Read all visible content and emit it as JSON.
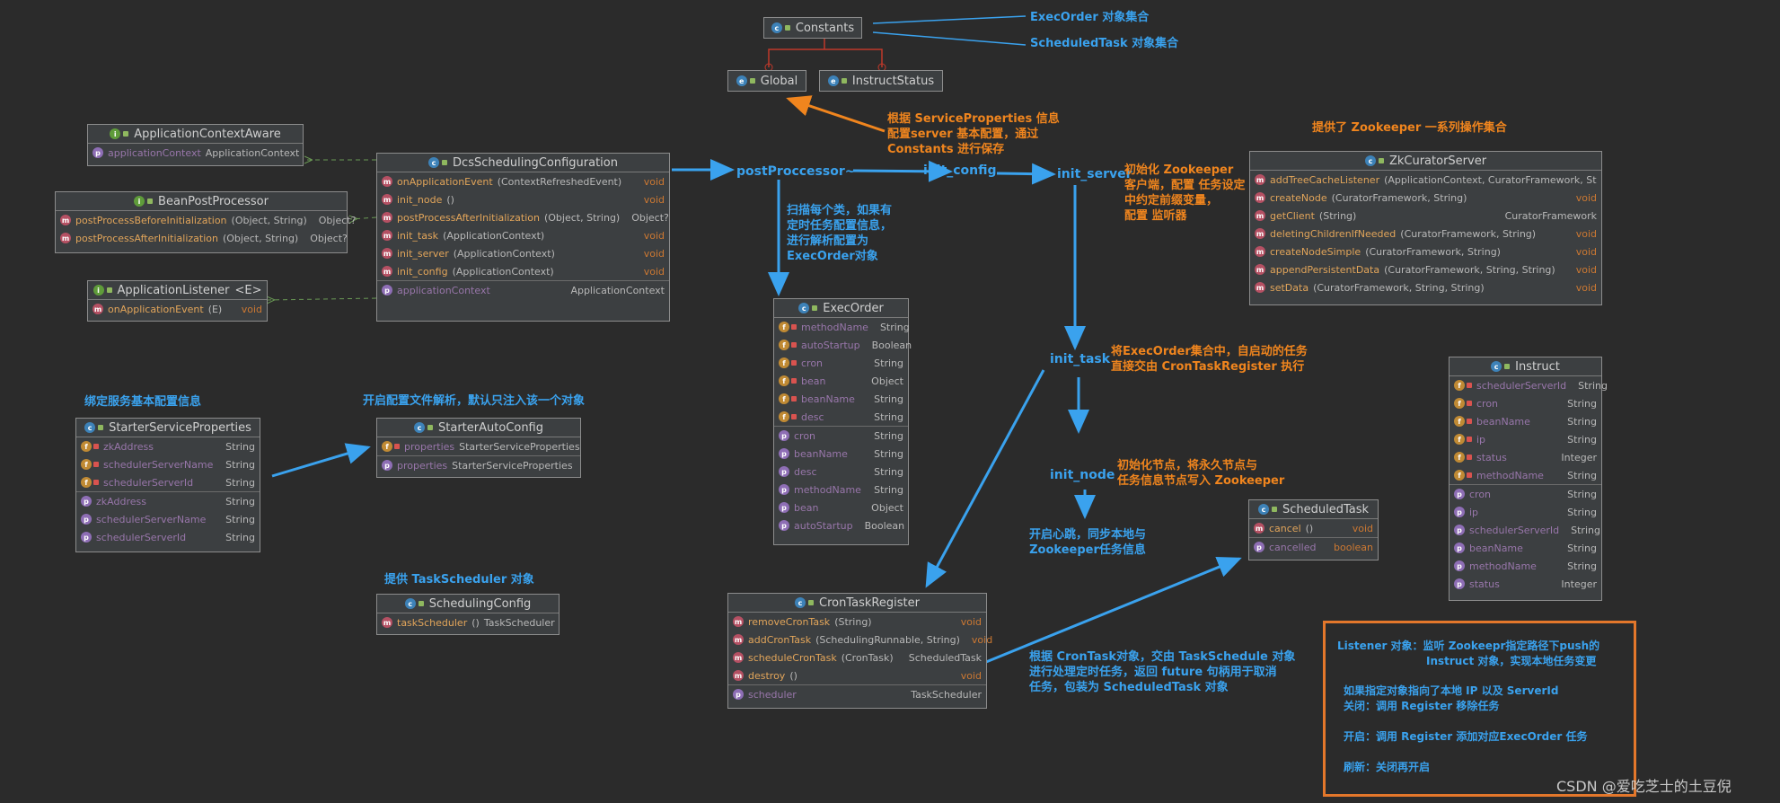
{
  "classes": {
    "constants": {
      "name": "Constants"
    },
    "global": {
      "name": "Global"
    },
    "instruct_status": {
      "name": "InstructStatus"
    },
    "application_context_aware": {
      "name": "ApplicationContextAware",
      "rows": [
        {
          "name": "applicationContext",
          "type": "ApplicationContext"
        }
      ]
    },
    "bean_post_processor": {
      "name": "BeanPostProcessor",
      "rows": [
        {
          "name": "postProcessBeforeInitialization",
          "args": "(Object, String)",
          "type": "Object?"
        },
        {
          "name": "postProcessAfterInitialization",
          "args": "(Object, String)",
          "type": "Object?"
        }
      ]
    },
    "application_listener": {
      "name": "ApplicationListener",
      "generic": "<E>",
      "rows": [
        {
          "name": "onApplicationEvent",
          "args": "(E)",
          "type": "void"
        }
      ]
    },
    "dcs_config": {
      "name": "DcsSchedulingConfiguration",
      "rows": [
        {
          "name": "onApplicationEvent",
          "args": "(ContextRefreshedEvent)",
          "type": "void"
        },
        {
          "name": "init_node",
          "args": "()",
          "type": "void"
        },
        {
          "name": "postProcessAfterInitialization",
          "args": "(Object, String)",
          "type": "Object?"
        },
        {
          "name": "init_task",
          "args": "(ApplicationContext)",
          "type": "void"
        },
        {
          "name": "init_server",
          "args": "(ApplicationContext)",
          "type": "void"
        },
        {
          "name": "init_config",
          "args": "(ApplicationContext)",
          "type": "void"
        },
        {
          "name": "applicationContext",
          "args": "",
          "type": "ApplicationContext"
        }
      ]
    },
    "exec_order": {
      "name": "ExecOrder",
      "rows": [
        {
          "name": "methodName",
          "type": "String"
        },
        {
          "name": "autoStartup",
          "type": "Boolean"
        },
        {
          "name": "cron",
          "type": "String"
        },
        {
          "name": "bean",
          "type": "Object"
        },
        {
          "name": "beanName",
          "type": "String"
        },
        {
          "name": "desc",
          "type": "String"
        },
        {
          "name": "cron",
          "type": "String"
        },
        {
          "name": "beanName",
          "type": "String"
        },
        {
          "name": "desc",
          "type": "String"
        },
        {
          "name": "methodName",
          "type": "String"
        },
        {
          "name": "bean",
          "type": "Object"
        },
        {
          "name": "autoStartup",
          "type": "Boolean"
        }
      ]
    },
    "zk_curator_server": {
      "name": "ZkCuratorServer",
      "rows": [
        {
          "name": "addTreeCacheListener",
          "args": "(ApplicationContext, CuratorFramework, String)",
          "type": ""
        },
        {
          "name": "createNode",
          "args": "(CuratorFramework, String)",
          "type": "void"
        },
        {
          "name": "getClient",
          "args": "(String)",
          "type": "CuratorFramework"
        },
        {
          "name": "deletingChildrenIfNeeded",
          "args": "(CuratorFramework, String)",
          "type": "void"
        },
        {
          "name": "createNodeSimple",
          "args": "(CuratorFramework, String)",
          "type": "void"
        },
        {
          "name": "appendPersistentData",
          "args": "(CuratorFramework, String, String)",
          "type": "void"
        },
        {
          "name": "setData",
          "args": "(CuratorFramework, String, String)",
          "type": "void"
        }
      ]
    },
    "instruct": {
      "name": "Instruct",
      "rows": [
        {
          "name": "schedulerServerId",
          "type": "String"
        },
        {
          "name": "cron",
          "type": "String"
        },
        {
          "name": "beanName",
          "type": "String"
        },
        {
          "name": "ip",
          "type": "String"
        },
        {
          "name": "status",
          "type": "Integer"
        },
        {
          "name": "methodName",
          "type": "String"
        },
        {
          "name": "cron",
          "type": "String"
        },
        {
          "name": "ip",
          "type": "String"
        },
        {
          "name": "schedulerServerId",
          "type": "String"
        },
        {
          "name": "beanName",
          "type": "String"
        },
        {
          "name": "methodName",
          "type": "String"
        },
        {
          "name": "status",
          "type": "Integer"
        }
      ]
    },
    "scheduled_task": {
      "name": "ScheduledTask",
      "rows": [
        {
          "name": "cancel",
          "args": "()",
          "type": "void"
        },
        {
          "name": "cancelled",
          "args": "",
          "type": "boolean"
        }
      ]
    },
    "starter_service_properties": {
      "name": "StarterServiceProperties",
      "rows": [
        {
          "name": "zkAddress",
          "type": "String"
        },
        {
          "name": "schedulerServerName",
          "type": "String"
        },
        {
          "name": "schedulerServerId",
          "type": "String"
        },
        {
          "name": "zkAddress",
          "type": "String"
        },
        {
          "name": "schedulerServerName",
          "type": "String"
        },
        {
          "name": "schedulerServerId",
          "type": "String"
        }
      ]
    },
    "starter_auto_config": {
      "name": "StarterAutoConfig",
      "rows": [
        {
          "name": "properties",
          "type": "StarterServiceProperties"
        },
        {
          "name": "properties",
          "type": "StarterServiceProperties"
        }
      ]
    },
    "scheduling_config": {
      "name": "SchedulingConfig",
      "rows": [
        {
          "name": "taskScheduler",
          "args": "()",
          "type": "TaskScheduler"
        }
      ]
    },
    "cron_task_register": {
      "name": "CronTaskRegister",
      "rows": [
        {
          "name": "removeCronTask",
          "args": "(String)",
          "type": "void"
        },
        {
          "name": "addCronTask",
          "args": "(SchedulingRunnable, String)",
          "type": "void"
        },
        {
          "name": "scheduleCronTask",
          "args": "(CronTask)",
          "type": "ScheduledTask"
        },
        {
          "name": "destroy",
          "args": "()",
          "type": "void"
        },
        {
          "name": "scheduler",
          "args": "",
          "type": "TaskScheduler"
        }
      ]
    }
  },
  "flow": {
    "post_processor": "postProccessor~",
    "init_config": "init_config",
    "init_server": "init_server",
    "init_task": "init_task",
    "init_node": "init_node"
  },
  "notes": {
    "exec_order_set": "ExecOrder 对象集合",
    "scheduled_task_set": "ScheduledTask 对象集合",
    "service_properties": [
      "根据 ServiceProperties 信息",
      "配置server 基本配置，通过",
      "Constants 进行保存"
    ],
    "zookeeper_ops": "提供了 Zookeeper 一系列操作集合",
    "init_zk": [
      "初始化 Zookeeper",
      "客户端，配置 任务设定",
      "中约定前缀变量，",
      "配置 监听器"
    ],
    "scan_classes": [
      "扫描每个类，如果有",
      "定时任务配置信息，",
      "进行解析配置为",
      "ExecOrder对象"
    ],
    "exec_order_auto": [
      "将ExecOrder集合中，自启动的任务",
      "直接交由 CronTaskRegister 执行"
    ],
    "bind_service": "绑定服务基本配置信息",
    "enable_config": "开启配置文件解析，默认只注入该一个对象",
    "init_node": [
      "初始化节点，将永久节点与",
      "任务信息节点写入 Zookeeper"
    ],
    "heartbeat": [
      "开启心跳，同步本地与",
      "Zookeeper任务信息"
    ],
    "task_scheduler": "提供 TaskScheduler 对象",
    "cron_task": [
      "根据 CronTask对象，交由 TaskSchedule 对象",
      "进行处理定时任务，返回 future 句柄用于取消",
      "任务，包装为 ScheduledTask 对象"
    ]
  },
  "legend": {
    "line1": "Listener 对象：监听 Zookeepr指定路径下push的",
    "line2": "Instruct 对象，实现本地任务变更",
    "line3": "如果指定对象指向了本地 IP 以及 ServerId",
    "line4": "关闭：调用 Register 移除任务",
    "line5": "开启：调用 Register 添加对应ExecOrder 任务",
    "line6": "刷新：关闭再开启"
  },
  "watermark": "CSDN @爱吃芝士的土豆倪",
  "colors": {
    "background": "#2b2b2b",
    "orange": "#f0851e",
    "blue": "#3aa2ee",
    "legend_border": "#e3772b",
    "dashed_green": "#6a9955"
  }
}
